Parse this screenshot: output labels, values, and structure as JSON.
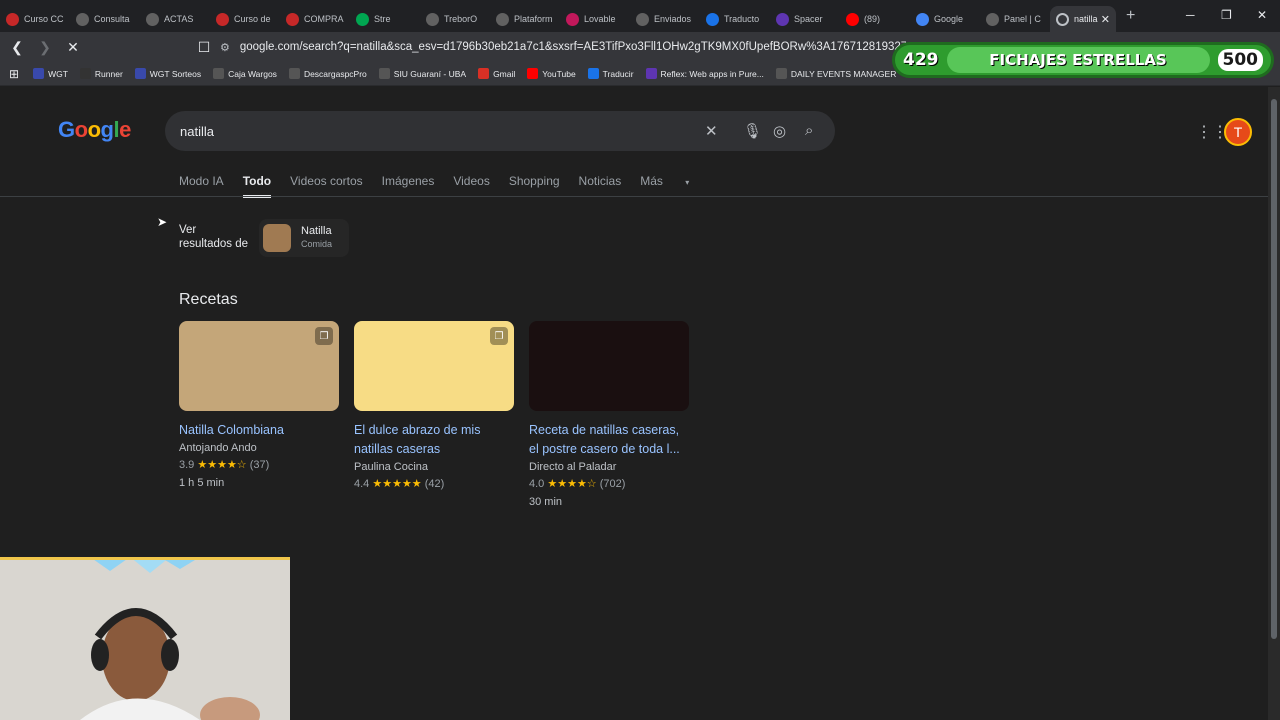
{
  "browser": {
    "tabs": [
      {
        "label": "Curso CC",
        "color": "#c62828"
      },
      {
        "label": "Consulta",
        "color": "#616161"
      },
      {
        "label": "ACTAS",
        "color": "#616161"
      },
      {
        "label": "Curso de",
        "color": "#c62828"
      },
      {
        "label": "COMPRA",
        "color": "#c62828"
      },
      {
        "label": "Stre",
        "color": "#00a651"
      },
      {
        "label": "TreborO",
        "color": "#616161"
      },
      {
        "label": "Plataform",
        "color": "#616161"
      },
      {
        "label": "Lovable",
        "color": "#c2185b"
      },
      {
        "label": "Enviados",
        "color": "#616161"
      },
      {
        "label": "Traducto",
        "color": "#1a73e8"
      },
      {
        "label": "Spacer",
        "color": "#5e35b1"
      },
      {
        "label": "(89)",
        "color": "#ff0000"
      },
      {
        "label": "Google",
        "color": "#4285f4"
      },
      {
        "label": "Panel | C",
        "color": "#616161"
      }
    ],
    "active_tab": {
      "label": "nat",
      "close": "✕"
    },
    "new_tab": "+",
    "url": "google.com/search?q=natilla&sca_esv=d1796b30eb21a7c1&sxsrf=AE3TifPxo3Fll1OHw2gTK9MX0fUpefBORw%3A1767128193270&ei=",
    "bookmarks": [
      {
        "label": "WGT",
        "color": "#3949ab"
      },
      {
        "label": "Runner",
        "color": "#333"
      },
      {
        "label": "WGT Sorteos",
        "color": "#3949ab"
      },
      {
        "label": "Caja Wargos",
        "color": "#555"
      },
      {
        "label": "DescargaspcPro",
        "color": "#555"
      },
      {
        "label": "SIU Guaraní - UBA",
        "color": "#555"
      },
      {
        "label": "Gmail",
        "color": "#d93025"
      },
      {
        "label": "YouTube",
        "color": "#ff0000"
      },
      {
        "label": "Traducir",
        "color": "#1a73e8"
      },
      {
        "label": "Reflex: Web apps in Pure...",
        "color": "#5e35b1"
      },
      {
        "label": "DAILY EVENTS MANAGER",
        "color": "#555"
      }
    ]
  },
  "overlay": {
    "left": "429",
    "label": "FICHAJES ESTRELLAS",
    "right": "500"
  },
  "google": {
    "logo": "Google",
    "query": "natilla",
    "tabs": [
      "Modo IA",
      "Todo",
      "Videos cortos",
      "Imágenes",
      "Videos",
      "Shopping",
      "Noticias",
      "Más"
    ],
    "see_results_label": "Ver resultados de",
    "entity": {
      "name": "Natilla",
      "type": "Comida"
    },
    "avatar_letter": "T",
    "recipes_title": "Recetas",
    "recipes": [
      {
        "title": "Natilla Colombiana",
        "source": "Antojando Ando",
        "rating": "3.9",
        "stars": "★★★★☆",
        "count": "(37)",
        "time": "1 h 5 min",
        "color": "#c4a679"
      },
      {
        "title": "El dulce abrazo de mis natillas caseras",
        "source": "Paulina Cocina",
        "rating": "4.4",
        "stars": "★★★★★",
        "count": "(42)",
        "time": "",
        "color": "#f7dc85"
      },
      {
        "title": "Receta de natillas caseras, el postre casero de toda l...",
        "source": "Directo al Paladar",
        "rating": "4.0",
        "stars": "★★★★☆",
        "count": "(702)",
        "time": "30 min",
        "color": "#1a0f10"
      }
    ]
  }
}
